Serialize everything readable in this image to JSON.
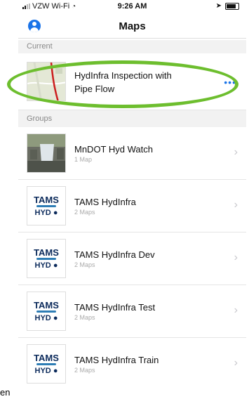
{
  "status": {
    "carrier": "VZW Wi-Fi",
    "time": "9:26 AM"
  },
  "nav": {
    "title": "Maps"
  },
  "sections": {
    "current": "Current",
    "groups": "Groups"
  },
  "current_map": {
    "title_line1": "HydInfra Inspection with",
    "title_line2": "Pipe Flow",
    "more": "•••"
  },
  "logo": {
    "line1": "TAMS",
    "line2": "HYD"
  },
  "groups": [
    {
      "title": "MnDOT Hyd Watch",
      "subtitle": "1 Map",
      "chevron": "›"
    },
    {
      "title": "TAMS HydInfra",
      "subtitle": "2 Maps",
      "chevron": "›"
    },
    {
      "title": "TAMS HydInfra Dev",
      "subtitle": "2 Maps",
      "chevron": "›"
    },
    {
      "title": "TAMS HydInfra Test",
      "subtitle": "2 Maps",
      "chevron": "›"
    },
    {
      "title": "TAMS HydInfra Train",
      "subtitle": "2 Maps",
      "chevron": "›"
    }
  ],
  "edge_text": "en",
  "colors": {
    "accent": "#1a73e8",
    "highlight_ring": "#6dbe2e",
    "logo_navy": "#0b2a5b"
  }
}
